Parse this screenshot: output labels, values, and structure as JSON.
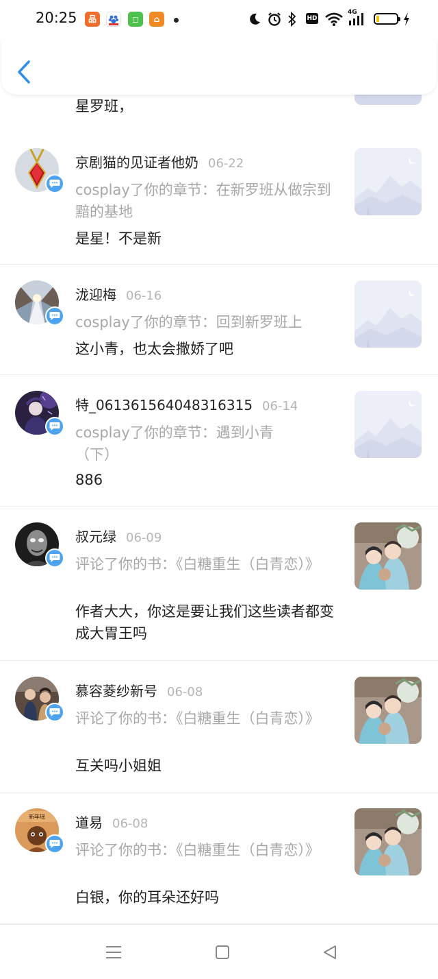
{
  "status_bar": {
    "time": "20:25",
    "network": "4G",
    "hd": "HD"
  },
  "header": {
    "back_icon": "chevron-left-icon"
  },
  "partial_item": {
    "comment": "星罗班，"
  },
  "notifications": [
    {
      "name": "京剧猫的见证者他奶",
      "date": "06-22",
      "action": "cosplay了你的章节：在新罗班从做宗到黯的基地",
      "comment": "是星！不是新",
      "thumb": "placeholder"
    },
    {
      "name": "泷迎梅",
      "date": "06-16",
      "action": "cosplay了你的章节：回到新罗班上",
      "comment": "这小青，也太会撒娇了吧",
      "thumb": "placeholder"
    },
    {
      "name": "特_061361564048316315",
      "date": "06-14",
      "action": "cosplay了你的章节：遇到小青（下）",
      "comment": "886",
      "thumb": "placeholder"
    },
    {
      "name": "叔元绿",
      "date": "06-09",
      "action": "评论了你的书：《白糖重生（白青恋）》",
      "comment": "作者大大，你这是要让我们这些读者都变成大胃王吗",
      "thumb": "cover"
    },
    {
      "name": "慕容菱纱新号",
      "date": "06-08",
      "action": "评论了你的书：《白糖重生（白青恋）》",
      "comment": "互关吗小姐姐",
      "thumb": "cover"
    },
    {
      "name": "道易",
      "date": "06-08",
      "action": "评论了你的书：《白糖重生（白青恋）》",
      "comment": "白银，你的耳朵还好吗",
      "thumb": "cover"
    }
  ],
  "nav_bar": {
    "menu_icon": "menu-icon",
    "home_icon": "home-icon",
    "back_icon": "back-triangle-icon"
  },
  "colors": {
    "accent": "#4ea3f0",
    "back_chevron": "#2f8fe8",
    "muted_text": "#a8a8a8",
    "date_text": "#b5b5b5"
  }
}
